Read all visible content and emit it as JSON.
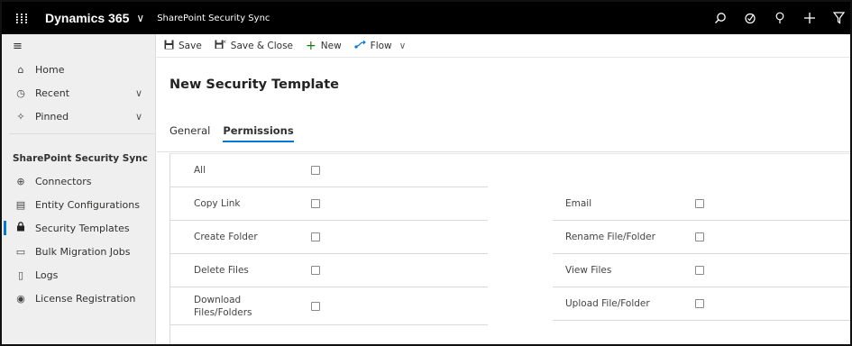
{
  "topbar": {
    "waffle_icon": "waffle-icon",
    "brand": "Dynamics 365",
    "brand_chevron": "chevron-down-icon",
    "app_name": "SharePoint Security Sync",
    "icons": [
      "search-icon",
      "task-icon",
      "lightbulb-icon",
      "plus-icon",
      "filter-icon"
    ]
  },
  "sidebar": {
    "items_top": [
      {
        "label": "Home",
        "icon": "home-icon"
      },
      {
        "label": "Recent",
        "icon": "clock-icon",
        "chevron": true
      },
      {
        "label": "Pinned",
        "icon": "pin-icon",
        "chevron": true
      }
    ],
    "group_title": "SharePoint Security Sync",
    "items_group": [
      {
        "label": "Connectors",
        "icon": "connector-icon"
      },
      {
        "label": "Entity Configurations",
        "icon": "table-icon"
      },
      {
        "label": "Security Templates",
        "icon": "lock-icon",
        "active": true
      },
      {
        "label": "Bulk Migration Jobs",
        "icon": "window-icon"
      },
      {
        "label": "Logs",
        "icon": "document-icon"
      },
      {
        "label": "License Registration",
        "icon": "dynamics-icon"
      }
    ]
  },
  "commandbar": {
    "save": "Save",
    "save_close": "Save & Close",
    "new": "New",
    "flow": "Flow"
  },
  "form": {
    "title": "New Security Template",
    "tabs": [
      "General",
      "Permissions"
    ],
    "selected_tab": "Permissions"
  },
  "permissions": {
    "left": [
      "All",
      "Copy Link",
      "Create Folder",
      "Delete Files",
      "Download Files/Folders"
    ],
    "right": [
      "Email",
      "Rename File/Folder",
      "View Files",
      "Upload File/Folder"
    ]
  },
  "colors": {
    "accent": "#0078d4",
    "topbar": "#000000",
    "sidebar": "#efefef",
    "new_plus": "#107c10"
  }
}
